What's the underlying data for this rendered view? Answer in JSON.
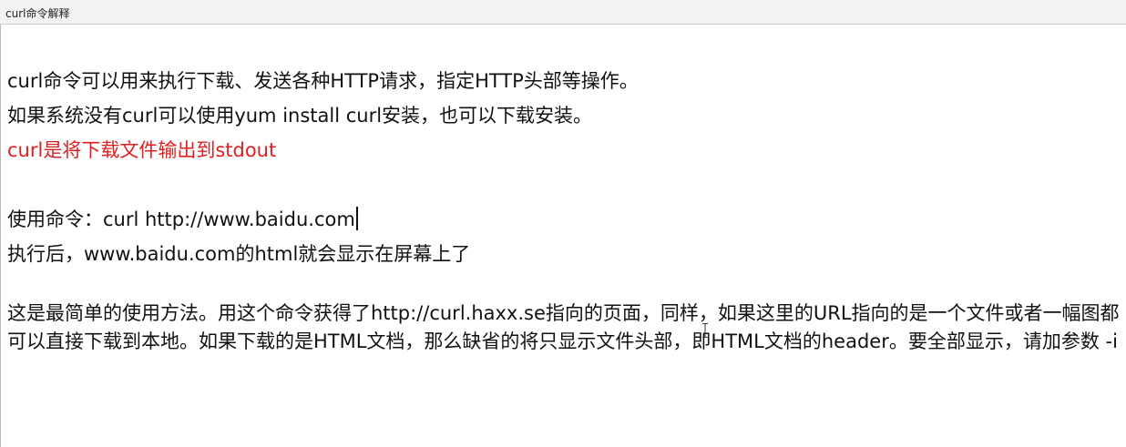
{
  "window": {
    "title": "curl命令解释"
  },
  "doc": {
    "line1": "curl命令可以用来执行下载、发送各种HTTP请求，指定HTTP头部等操作。",
    "line2": "如果系统没有curl可以使用yum install curl安装，也可以下载安装。",
    "line3_red": "curl是将下载文件输出到stdout",
    "line4": "使用命令：curl http://www.baidu.com",
    "line5": "执行后，www.baidu.com的html就会显示在屏幕上了",
    "para": "这是最简单的使用方法。用这个命令获得了http://curl.haxx.se指向的页面，同样，如果这里的URL指向的是一个文件或者一幅图都可以直接下载到本地。如果下载的是HTML文档，那么缺省的将只显示文件头部，即HTML文档的header。要全部显示，请加参数 -i"
  },
  "colors": {
    "text": "#111111",
    "highlight": "#e02020",
    "titlebar_bg": "#f2f2f2"
  }
}
